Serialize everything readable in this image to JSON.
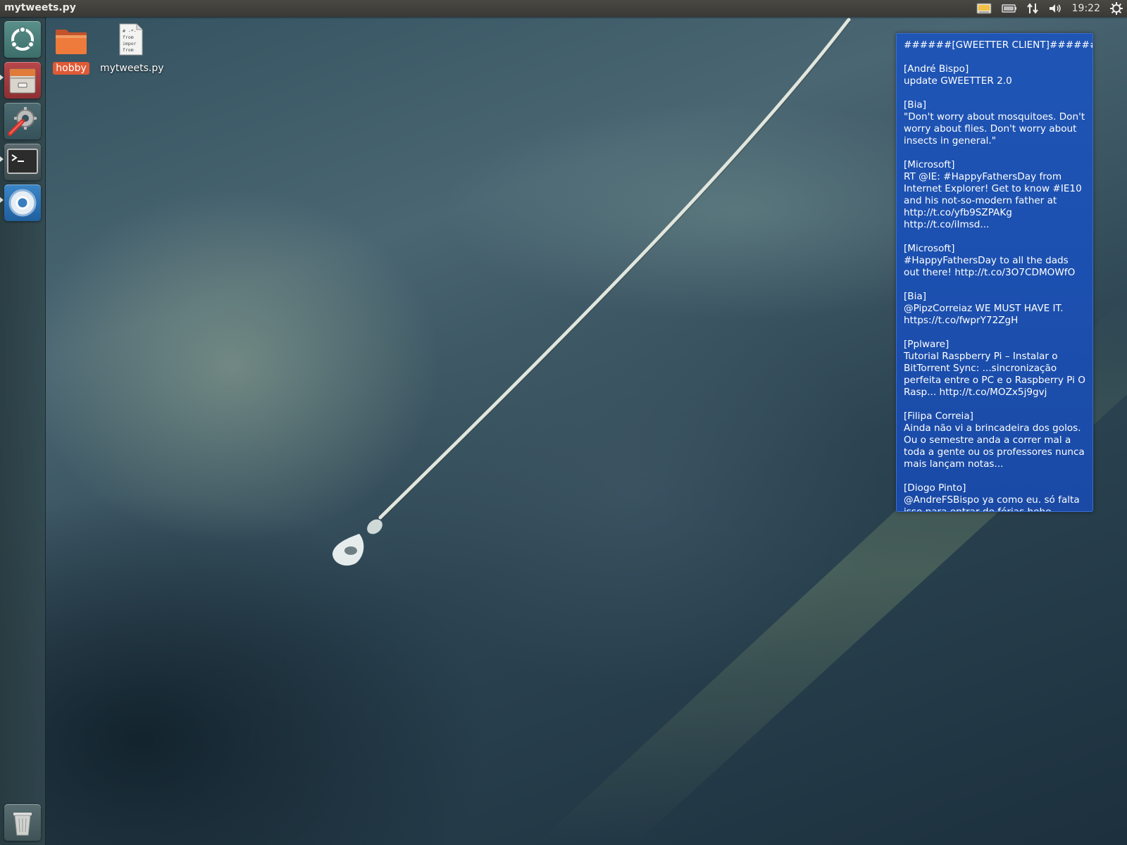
{
  "panel": {
    "app_title": "mytweets.py",
    "clock": "19:22",
    "indicators": [
      "keyboard-indicator-icon",
      "battery-icon",
      "network-icon",
      "volume-icon",
      "power-gear-icon"
    ]
  },
  "launcher": {
    "items": [
      "dash-home-icon",
      "files-icon",
      "system-settings-icon",
      "terminal-icon",
      "chromium-icon",
      "trash-icon"
    ]
  },
  "desktop": {
    "icons": [
      {
        "label": "hobby",
        "icon": "folder-icon"
      },
      {
        "label": "mytweets.py",
        "icon": "python-file-icon",
        "preview_lines": [
          "# -*-",
          "from",
          "impor",
          "from"
        ]
      }
    ]
  },
  "gweetter": {
    "title": "######[GWEETTER CLIENT]######",
    "accent": "#1f55b5",
    "tweets": [
      {
        "author": "[André Bispo]",
        "text": "update GWEETTER 2.0"
      },
      {
        "author": "[Bia]",
        "text": "\"Don't worry about mosquitoes. Don't worry about flies. Don't worry about insects in general.\""
      },
      {
        "author": "[Microsoft]",
        "text": "RT @IE: #HappyFathersDay from Internet Explorer! Get to know #IE10 and his not-so-modern father at http://t.co/yfb9SZPAKg http://t.co/iImsd..."
      },
      {
        "author": "[Microsoft]",
        "text": "#HappyFathersDay to all the dads out there! http://t.co/3O7CDMOWfO"
      },
      {
        "author": "[Bia]",
        "text": "@PipzCorreiaz WE MUST HAVE IT. https://t.co/fwprY72ZgH"
      },
      {
        "author": "[Pplware]",
        "text": "Tutorial Raspberry Pi – Instalar o BitTorrent Sync: ...sincronização perfeita entre o PC e o Raspberry Pi O Rasp... http://t.co/MOZx5j9gvj"
      },
      {
        "author": "[Filipa Correia]",
        "text": "Ainda não vi a brincadeira dos golos. Ou o semestre anda a correr mal a toda a gente ou os professores nunca mais lançam notas..."
      },
      {
        "author": "[Diogo Pinto]",
        "text": "@AndreFSBispo ya como eu. só falta isso para entrar de férias hehe"
      }
    ]
  }
}
